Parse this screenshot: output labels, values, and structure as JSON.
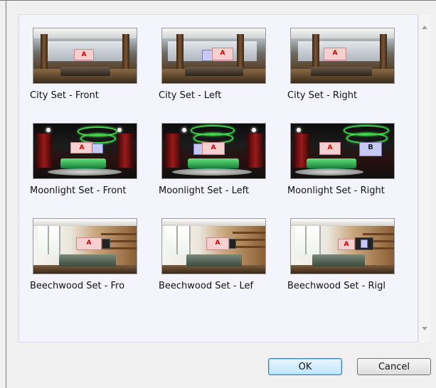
{
  "gallery": {
    "items": [
      {
        "caption": "City Set - Front",
        "style": "city",
        "screen": "A"
      },
      {
        "caption": "City Set - Left",
        "style": "city",
        "screen": "A"
      },
      {
        "caption": "City Set - Right",
        "style": "city",
        "screen": "A"
      },
      {
        "caption": "Moonlight Set - Front",
        "style": "moonlight",
        "screen": "A"
      },
      {
        "caption": "Moonlight Set - Left",
        "style": "moonlight",
        "screen": "A"
      },
      {
        "caption": "Moonlight Set - Right",
        "style": "moonlight",
        "screen": "A",
        "screen2": "B"
      },
      {
        "caption": "Beechwood Set - Fro",
        "style": "beechwood",
        "screen": "A"
      },
      {
        "caption": "Beechwood Set - Lef",
        "style": "beechwood",
        "screen": "A"
      },
      {
        "caption": "Beechwood Set - Rigl",
        "style": "beechwood",
        "screen": "A"
      }
    ]
  },
  "buttons": {
    "ok_label": "OK",
    "cancel_label": "Cancel"
  },
  "icons": {
    "scroll_up": "scroll-up-arrow-icon",
    "scroll_down": "scroll-down-arrow-icon"
  },
  "colors": {
    "gallery_background": "#f4f4fc",
    "default_button_border": "#3c7fb1"
  }
}
